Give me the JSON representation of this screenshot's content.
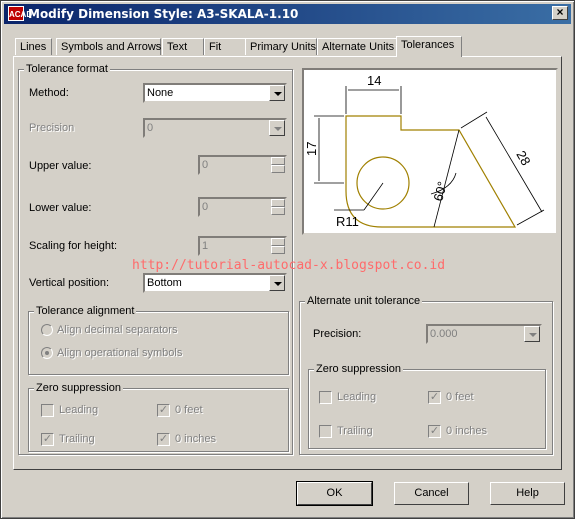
{
  "window": {
    "title": "Modify Dimension Style: A3-SKALA-1.10",
    "icon_text": "ACAD",
    "close_glyph": "×"
  },
  "tabs": [
    {
      "label": "Lines"
    },
    {
      "label": "Symbols and Arrows"
    },
    {
      "label": "Text"
    },
    {
      "label": "Fit"
    },
    {
      "label": "Primary Units"
    },
    {
      "label": "Alternate Units"
    },
    {
      "label": "Tolerances",
      "active": true
    }
  ],
  "tolerance_format": {
    "title": "Tolerance format",
    "method_label": "Method:",
    "method_value": "None",
    "precision_label": "Precision",
    "precision_value": "0",
    "upper_label": "Upper value:",
    "upper_value": "0",
    "lower_label": "Lower value:",
    "lower_value": "0",
    "scaling_label": "Scaling for height:",
    "scaling_value": "1",
    "vertical_label": "Vertical position:",
    "vertical_value": "Bottom"
  },
  "tolerance_alignment": {
    "title": "Tolerance alignment",
    "option1": "Align decimal separators",
    "option2": "Align operational symbols",
    "selected": "option2"
  },
  "zero_suppression": {
    "title": "Zero suppression",
    "leading": "Leading",
    "leading_checked": false,
    "trailing": "Trailing",
    "trailing_checked": true,
    "feet": "0 feet",
    "feet_checked": true,
    "inches": "0 inches",
    "inches_checked": true
  },
  "alternate_tolerance": {
    "title": "Alternate unit tolerance",
    "precision_label": "Precision:",
    "precision_value": "0.000",
    "zero_title": "Zero suppression",
    "leading": "Leading",
    "leading_checked": false,
    "trailing": "Trailing",
    "trailing_checked": false,
    "feet": "0 feet",
    "feet_checked": true,
    "inches": "0 inches",
    "inches_checked": true
  },
  "preview": {
    "dim_top": "14",
    "dim_left": "17",
    "dim_diag": "28",
    "dim_angle": "60°",
    "dim_radius": "R11",
    "shape_color": "#a08000"
  },
  "watermark": "http://tutorial-autocad-x.blogspot.co.id",
  "buttons": {
    "ok": "OK",
    "cancel": "Cancel",
    "help": "Help"
  },
  "colors": {
    "titlebar": "#0a246a",
    "watermark": "#ff6b6b"
  }
}
